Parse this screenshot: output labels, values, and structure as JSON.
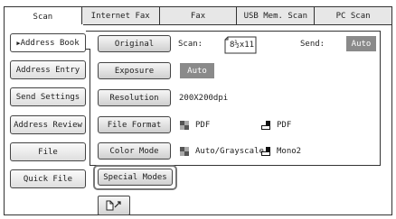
{
  "tabs": [
    "Scan",
    "Internet Fax",
    "Fax",
    "USB Mem. Scan",
    "PC Scan"
  ],
  "sidebar": [
    {
      "label": "Address Book",
      "active": true,
      "arrow": true
    },
    {
      "label": "Address Entry"
    },
    {
      "label": "Send Settings"
    },
    {
      "label": "Address Review"
    },
    {
      "label": "File"
    },
    {
      "label": "Quick File"
    }
  ],
  "settings": {
    "original_button": "Original",
    "scan_label": "Scan:",
    "scan_size": "8½x11",
    "send_label": "Send:",
    "send_value": "Auto",
    "exposure_button": "Exposure",
    "exposure_value": "Auto",
    "resolution_button": "Resolution",
    "resolution_value": "200X200dpi",
    "file_format_button": "File Format",
    "file_format_color_value": "PDF",
    "file_format_mono_value": "PDF",
    "color_mode_button": "Color Mode",
    "color_mode_color_value": "Auto/Grayscale",
    "color_mode_mono_value": "Mono2",
    "special_modes_button": "Special Modes"
  },
  "icons": {
    "arrow": "▶",
    "color_squares": [
      "#555555",
      "#aaaaaa"
    ],
    "mono_square": "#111111",
    "corner": "document-corner-icon"
  }
}
